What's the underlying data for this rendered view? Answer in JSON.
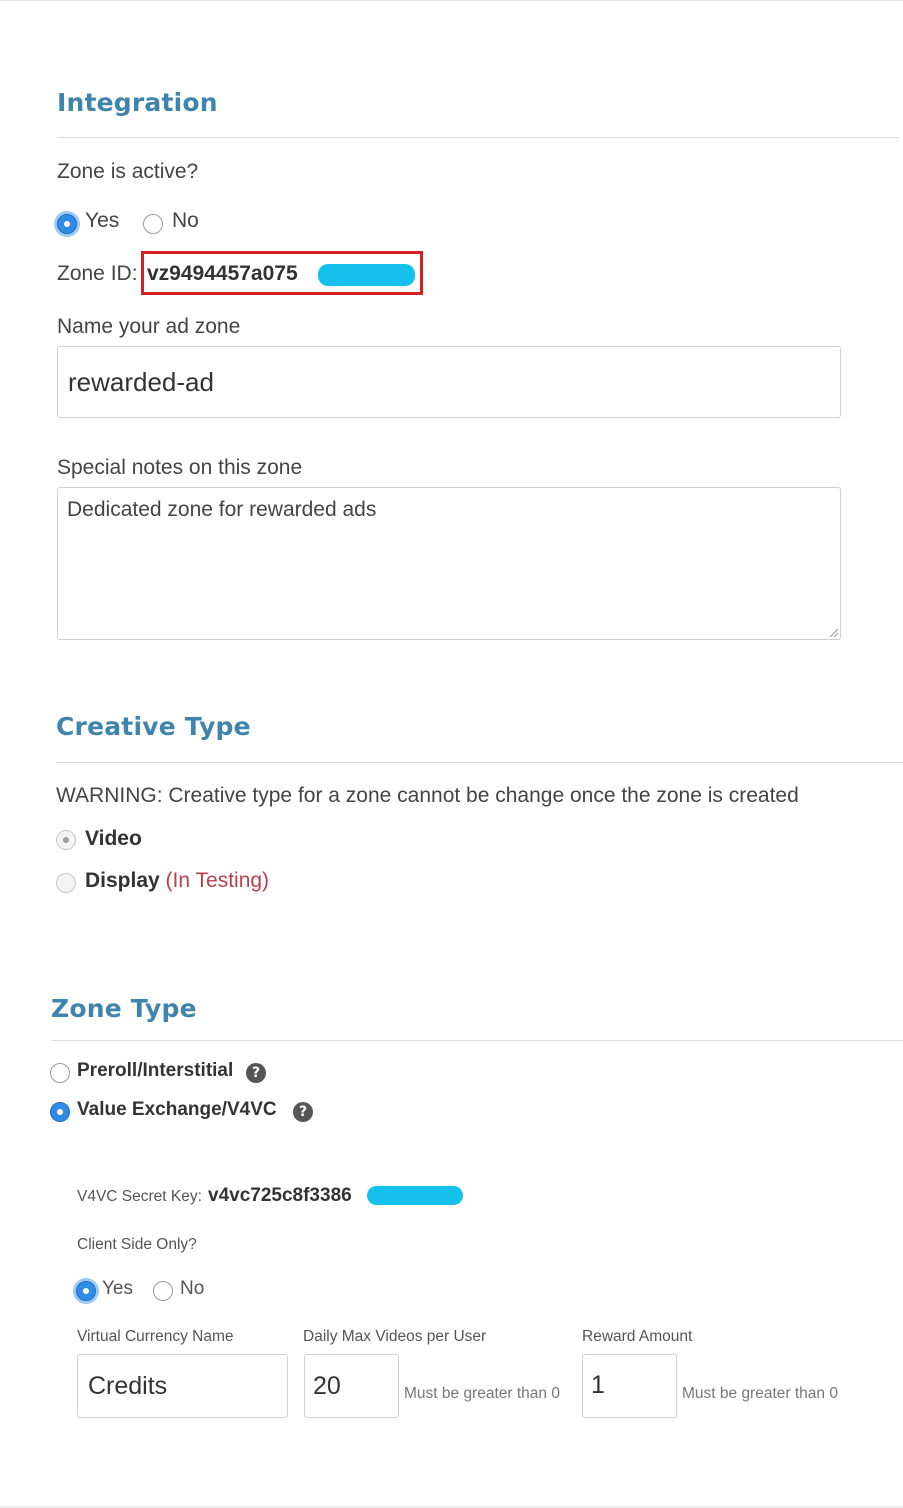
{
  "integration": {
    "title": "Integration",
    "active_label": "Zone is active?",
    "yes": "Yes",
    "no": "No",
    "active_value": "Yes",
    "zone_id_label": "Zone ID:",
    "zone_id_value": "vz9494457a075",
    "name_label": "Name your ad zone",
    "name_value": "rewarded-ad",
    "notes_label": "Special notes on this zone",
    "notes_value": "Dedicated zone for rewarded ads"
  },
  "creative": {
    "title": "Creative Type",
    "warning": "WARNING: Creative type for a zone cannot be change once the zone is created",
    "video": "Video",
    "display": "Display",
    "display_note": "(In Testing)",
    "selected": "Video"
  },
  "zone_type": {
    "title": "Zone Type",
    "preroll": "Preroll/Interstitial",
    "v4vc": "Value Exchange/V4VC",
    "help_glyph": "?",
    "selected": "Value Exchange/V4VC",
    "secret_label": "V4VC Secret Key:",
    "secret_value": "v4vc725c8f3386",
    "client_label": "Client Side Only?",
    "yes": "Yes",
    "no": "No",
    "client_value": "Yes",
    "currency_label": "Virtual Currency Name",
    "currency_value": "Credits",
    "daily_label": "Daily Max Videos per User",
    "daily_value": "20",
    "daily_hint": "Must be greater than 0",
    "reward_label": "Reward Amount",
    "reward_value": "1",
    "reward_hint": "Must be greater than 0"
  },
  "colors": {
    "accent": "#3f84ad",
    "radio_selected": "#2f8be6",
    "highlight_box": "#d81f26",
    "redaction": "#16c0ec",
    "testing_note": "#b5424a"
  }
}
